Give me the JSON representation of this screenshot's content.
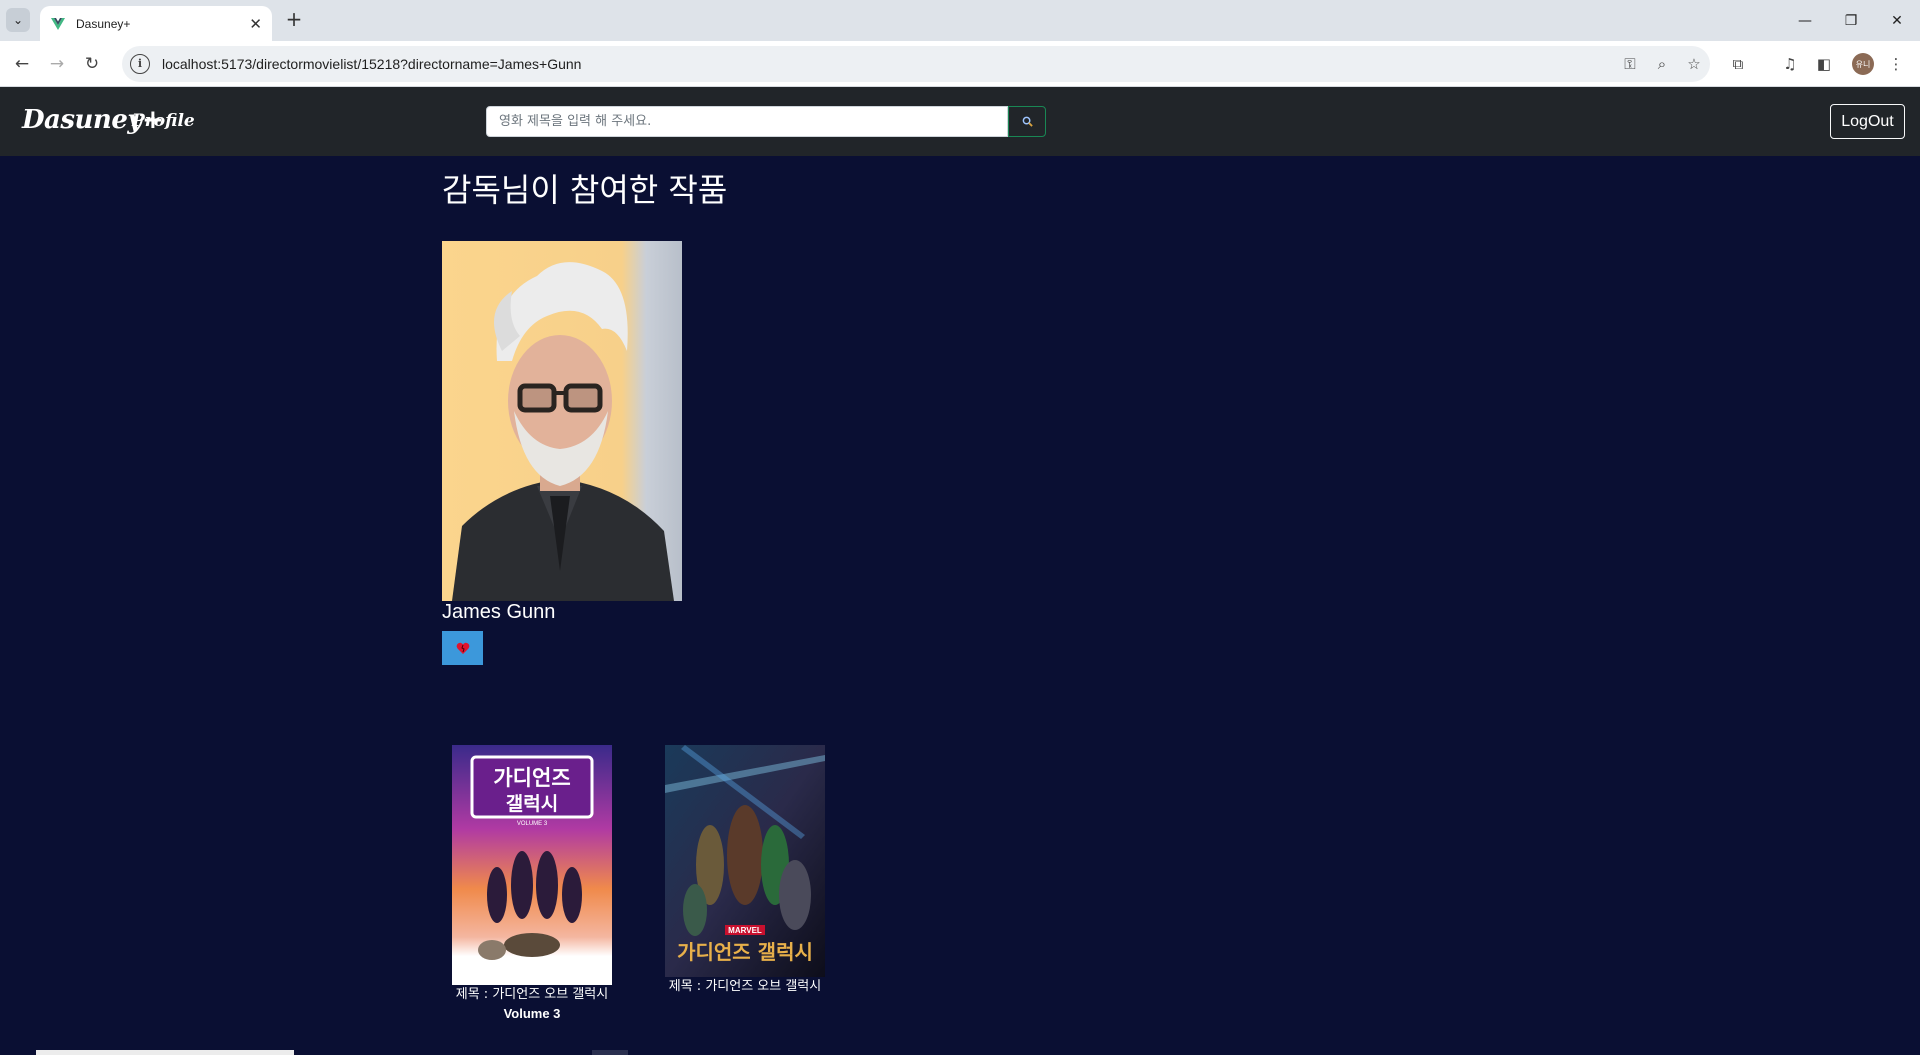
{
  "browser": {
    "tab_title": "Dasuney+",
    "url": "localhost:5173/directormovielist/15218?directorname=James+Gunn",
    "profile_initials": "유니"
  },
  "nav": {
    "brand": "Dasuney+",
    "profile_label": "Profile",
    "search_placeholder": "영화 제목을 입력 해 주세요.",
    "search_icon": "magnifier-icon",
    "logout_label": "LogOut"
  },
  "page": {
    "title": "감독님이 참여한 작품",
    "director_name": "James Gunn",
    "like_icon": "heart-icon"
  },
  "movies": [
    {
      "title": "제목 : 가디언즈 오브 갤럭시",
      "subtitle": "Volume 3",
      "poster_text": "가디언즈 갤럭시",
      "poster_small": "VOLUME 3"
    },
    {
      "title": "제목 : 가디언즈 오브 갤럭시",
      "subtitle": "",
      "poster_text": "가디언즈 오브 갤럭시",
      "poster_small": "MARVEL"
    }
  ],
  "colors": {
    "page_bg": "#0a0f33",
    "navbar_bg": "#212529",
    "like_button": "#3c98db",
    "search_border": "#198754"
  }
}
